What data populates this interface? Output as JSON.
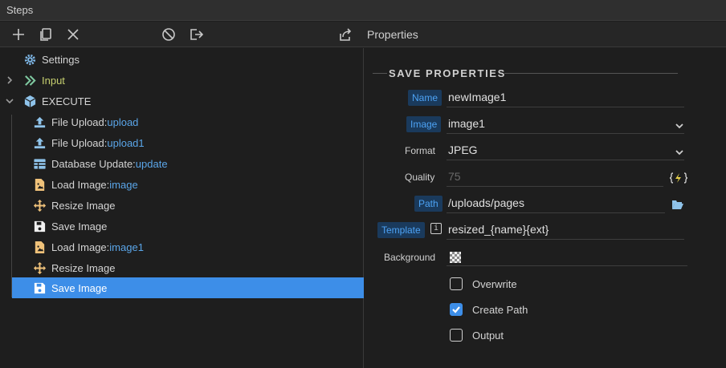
{
  "window": {
    "title": "Steps"
  },
  "toolbar": {
    "panel_title": "Properties"
  },
  "tree": {
    "items": [
      {
        "label": "Settings",
        "value": ""
      },
      {
        "label": "Input",
        "value": ""
      },
      {
        "label": "EXECUTE",
        "value": ""
      },
      {
        "label": "File Upload: ",
        "value": "upload"
      },
      {
        "label": "File Upload: ",
        "value": "upload1"
      },
      {
        "label": "Database Update: ",
        "value": "update"
      },
      {
        "label": "Load Image: ",
        "value": "image"
      },
      {
        "label": "Resize Image",
        "value": ""
      },
      {
        "label": "Save Image",
        "value": ""
      },
      {
        "label": "Load Image: ",
        "value": "image1"
      },
      {
        "label": "Resize Image",
        "value": ""
      },
      {
        "label": "Save Image",
        "value": ""
      }
    ]
  },
  "properties": {
    "section_title": "SAVE PROPERTIES",
    "name": {
      "label": "Name",
      "value": "newImage1"
    },
    "image": {
      "label": "Image",
      "value": "image1"
    },
    "format": {
      "label": "Format",
      "value": "JPEG"
    },
    "quality": {
      "label": "Quality",
      "value": "75"
    },
    "path": {
      "label": "Path",
      "value": "/uploads/pages"
    },
    "template": {
      "label": "Template",
      "value": "resized_{name}{ext}"
    },
    "background": {
      "label": "Background"
    },
    "overwrite": {
      "label": "Overwrite",
      "checked": false
    },
    "create_path": {
      "label": "Create Path",
      "checked": true
    },
    "output": {
      "label": "Output",
      "checked": false
    }
  },
  "colors": {
    "accent": "#3d8ee8",
    "value_text": "#5aa5e8",
    "input_label": "#c6cf6f"
  },
  "icons": {
    "settings": "gear-icon",
    "input": "double-chevron-right-icon",
    "execute": "cube-icon",
    "file_upload": "upload-icon",
    "database_update": "table-icon",
    "load_image": "image-file-icon",
    "resize_image": "move-arrows-icon",
    "save_image": "floppy-disk-icon"
  }
}
